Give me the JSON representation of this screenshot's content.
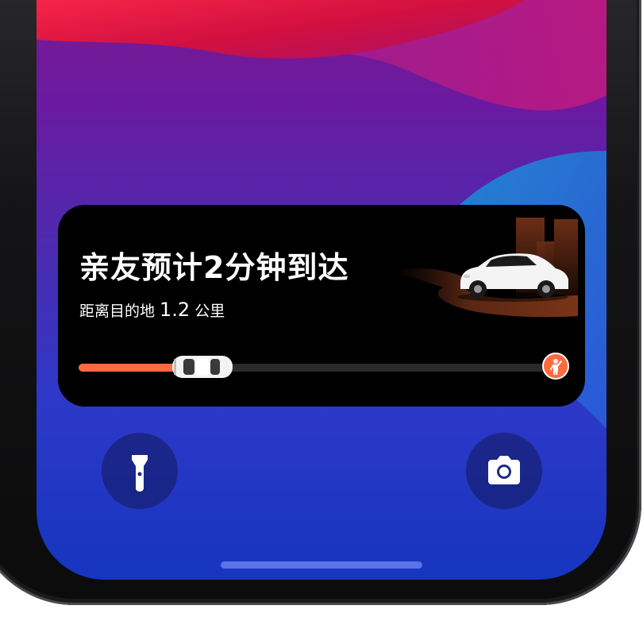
{
  "activity": {
    "title": "亲友预计2分钟到达",
    "subtitle_prefix": "距离目的地",
    "distance": "1.2",
    "unit": "公里",
    "progress_fraction": 0.21
  },
  "colors": {
    "accent": "#ff6a3d",
    "card": "#000000",
    "track": "#2a2a2c"
  },
  "icons": {
    "flashlight": "flashlight-icon",
    "camera": "camera-icon",
    "destination": "person-waving-icon",
    "car": "car-icon"
  }
}
